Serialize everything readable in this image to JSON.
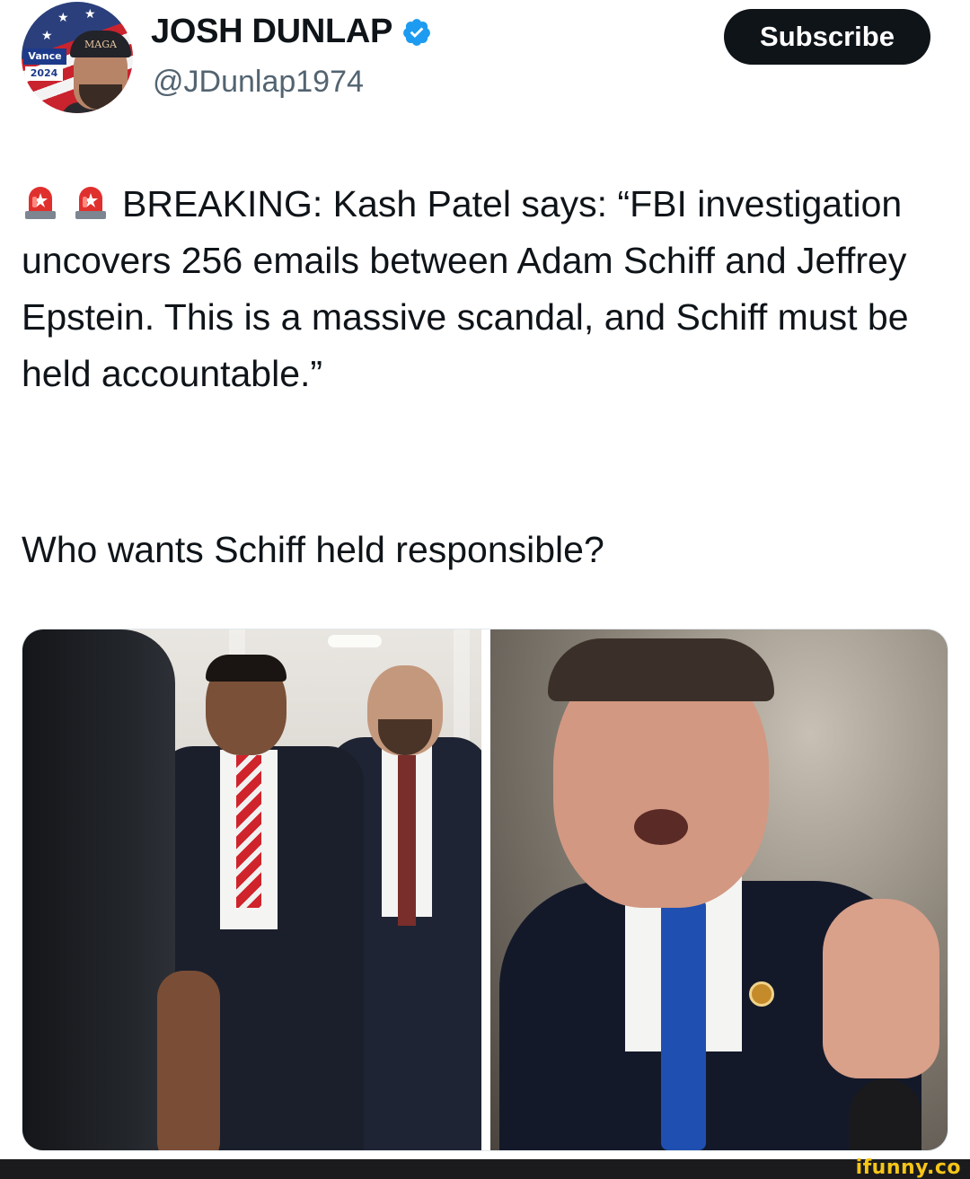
{
  "author": {
    "display_name": "JOSH DUNLAP",
    "handle": "@JDunlap1974",
    "verified": true,
    "verified_color": "#1d9bf0",
    "avatar": {
      "badge_top": "Vance",
      "badge_bottom": "2024",
      "hat_text": "MAGA"
    }
  },
  "actions": {
    "subscribe_label": "Subscribe"
  },
  "post": {
    "icons": [
      "siren-icon",
      "siren-icon"
    ],
    "paragraph1": "BREAKING: Kash Patel says: “FBI investigation uncovers 256 emails between Adam Schiff and Jeffrey Epstein. This is a massive scandal, and Schiff must be held accountable.”",
    "paragraph2": "Who wants Schiff held responsible?"
  },
  "media": {
    "count": 2
  },
  "watermark": "ifunny.co"
}
